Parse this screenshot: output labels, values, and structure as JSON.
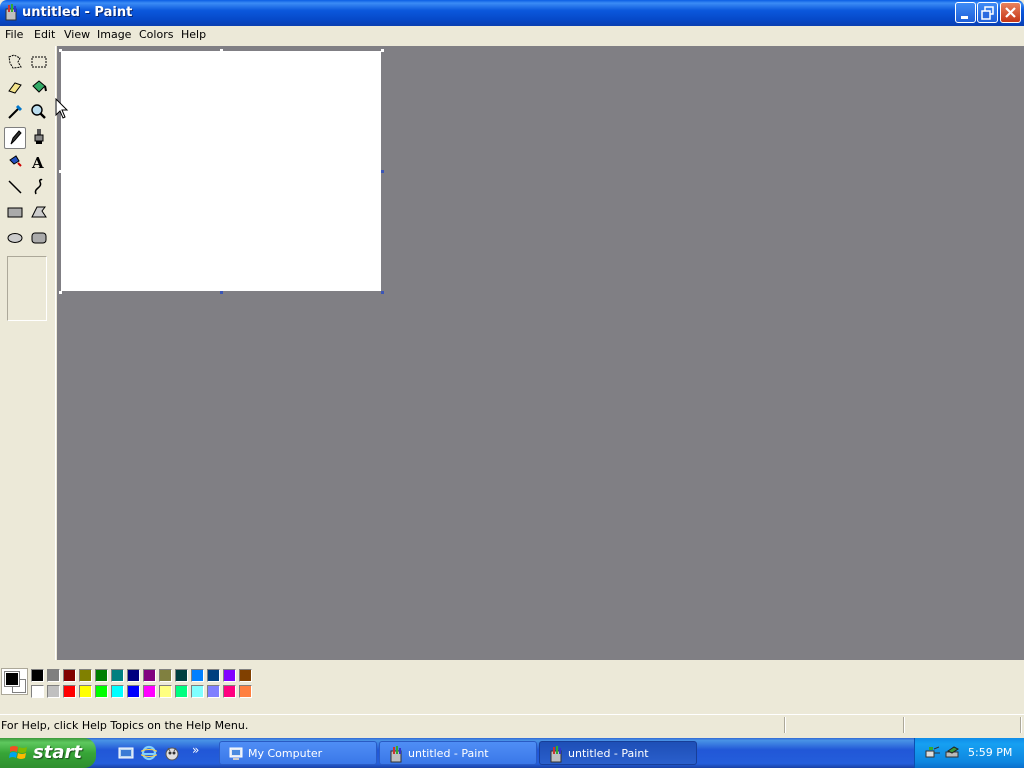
{
  "window": {
    "title": "untitled - Paint",
    "buttons": {
      "minimize": "minimize",
      "maximize": "restore",
      "close": "close"
    }
  },
  "menu": [
    "File",
    "Edit",
    "View",
    "Image",
    "Colors",
    "Help"
  ],
  "tools": [
    {
      "name": "free-form-select",
      "icon": "free-select-icon"
    },
    {
      "name": "select",
      "icon": "rect-select-icon"
    },
    {
      "name": "eraser",
      "icon": "eraser-icon"
    },
    {
      "name": "fill-with-color",
      "icon": "paint-bucket-icon"
    },
    {
      "name": "pick-color",
      "icon": "eyedropper-icon"
    },
    {
      "name": "magnifier",
      "icon": "magnifier-icon"
    },
    {
      "name": "pencil",
      "icon": "pencil-icon",
      "active": true
    },
    {
      "name": "brush",
      "icon": "brush-icon"
    },
    {
      "name": "airbrush",
      "icon": "airbrush-icon"
    },
    {
      "name": "text",
      "icon": "text-icon"
    },
    {
      "name": "line",
      "icon": "line-icon"
    },
    {
      "name": "curve",
      "icon": "curve-icon"
    },
    {
      "name": "rectangle",
      "icon": "rectangle-icon"
    },
    {
      "name": "polygon",
      "icon": "polygon-icon"
    },
    {
      "name": "ellipse",
      "icon": "ellipse-icon"
    },
    {
      "name": "rounded-rectangle",
      "icon": "rounded-rectangle-icon"
    }
  ],
  "colors": {
    "foreground": "#000000",
    "background": "#ffffff",
    "palette_top": [
      "#000000",
      "#808080",
      "#800000",
      "#808000",
      "#008000",
      "#008080",
      "#000080",
      "#800080",
      "#808040",
      "#004040",
      "#0080ff",
      "#004080",
      "#8000ff",
      "#804000"
    ],
    "palette_bottom": [
      "#ffffff",
      "#c0c0c0",
      "#ff0000",
      "#ffff00",
      "#00ff00",
      "#00ffff",
      "#0000ff",
      "#ff00ff",
      "#ffff80",
      "#00ff80",
      "#80ffff",
      "#8080ff",
      "#ff0080",
      "#ff8040"
    ]
  },
  "status": {
    "help_text": "For Help, click Help Topics on the Help Menu."
  },
  "taskbar": {
    "start_label": "start",
    "quick_launch": [
      "show-desktop-icon",
      "internet-explorer-icon",
      "media-player-icon"
    ],
    "overflow": "»",
    "tasks": [
      {
        "label": "My Computer",
        "icon": "my-computer-icon",
        "active": false
      },
      {
        "label": "untitled - Paint",
        "icon": "paint-icon",
        "active": false
      },
      {
        "label": "untitled - Paint",
        "icon": "paint-icon",
        "active": true
      }
    ],
    "tray_icons": [
      "network-icon",
      "safely-remove-icon"
    ],
    "clock": "5:59 PM"
  }
}
